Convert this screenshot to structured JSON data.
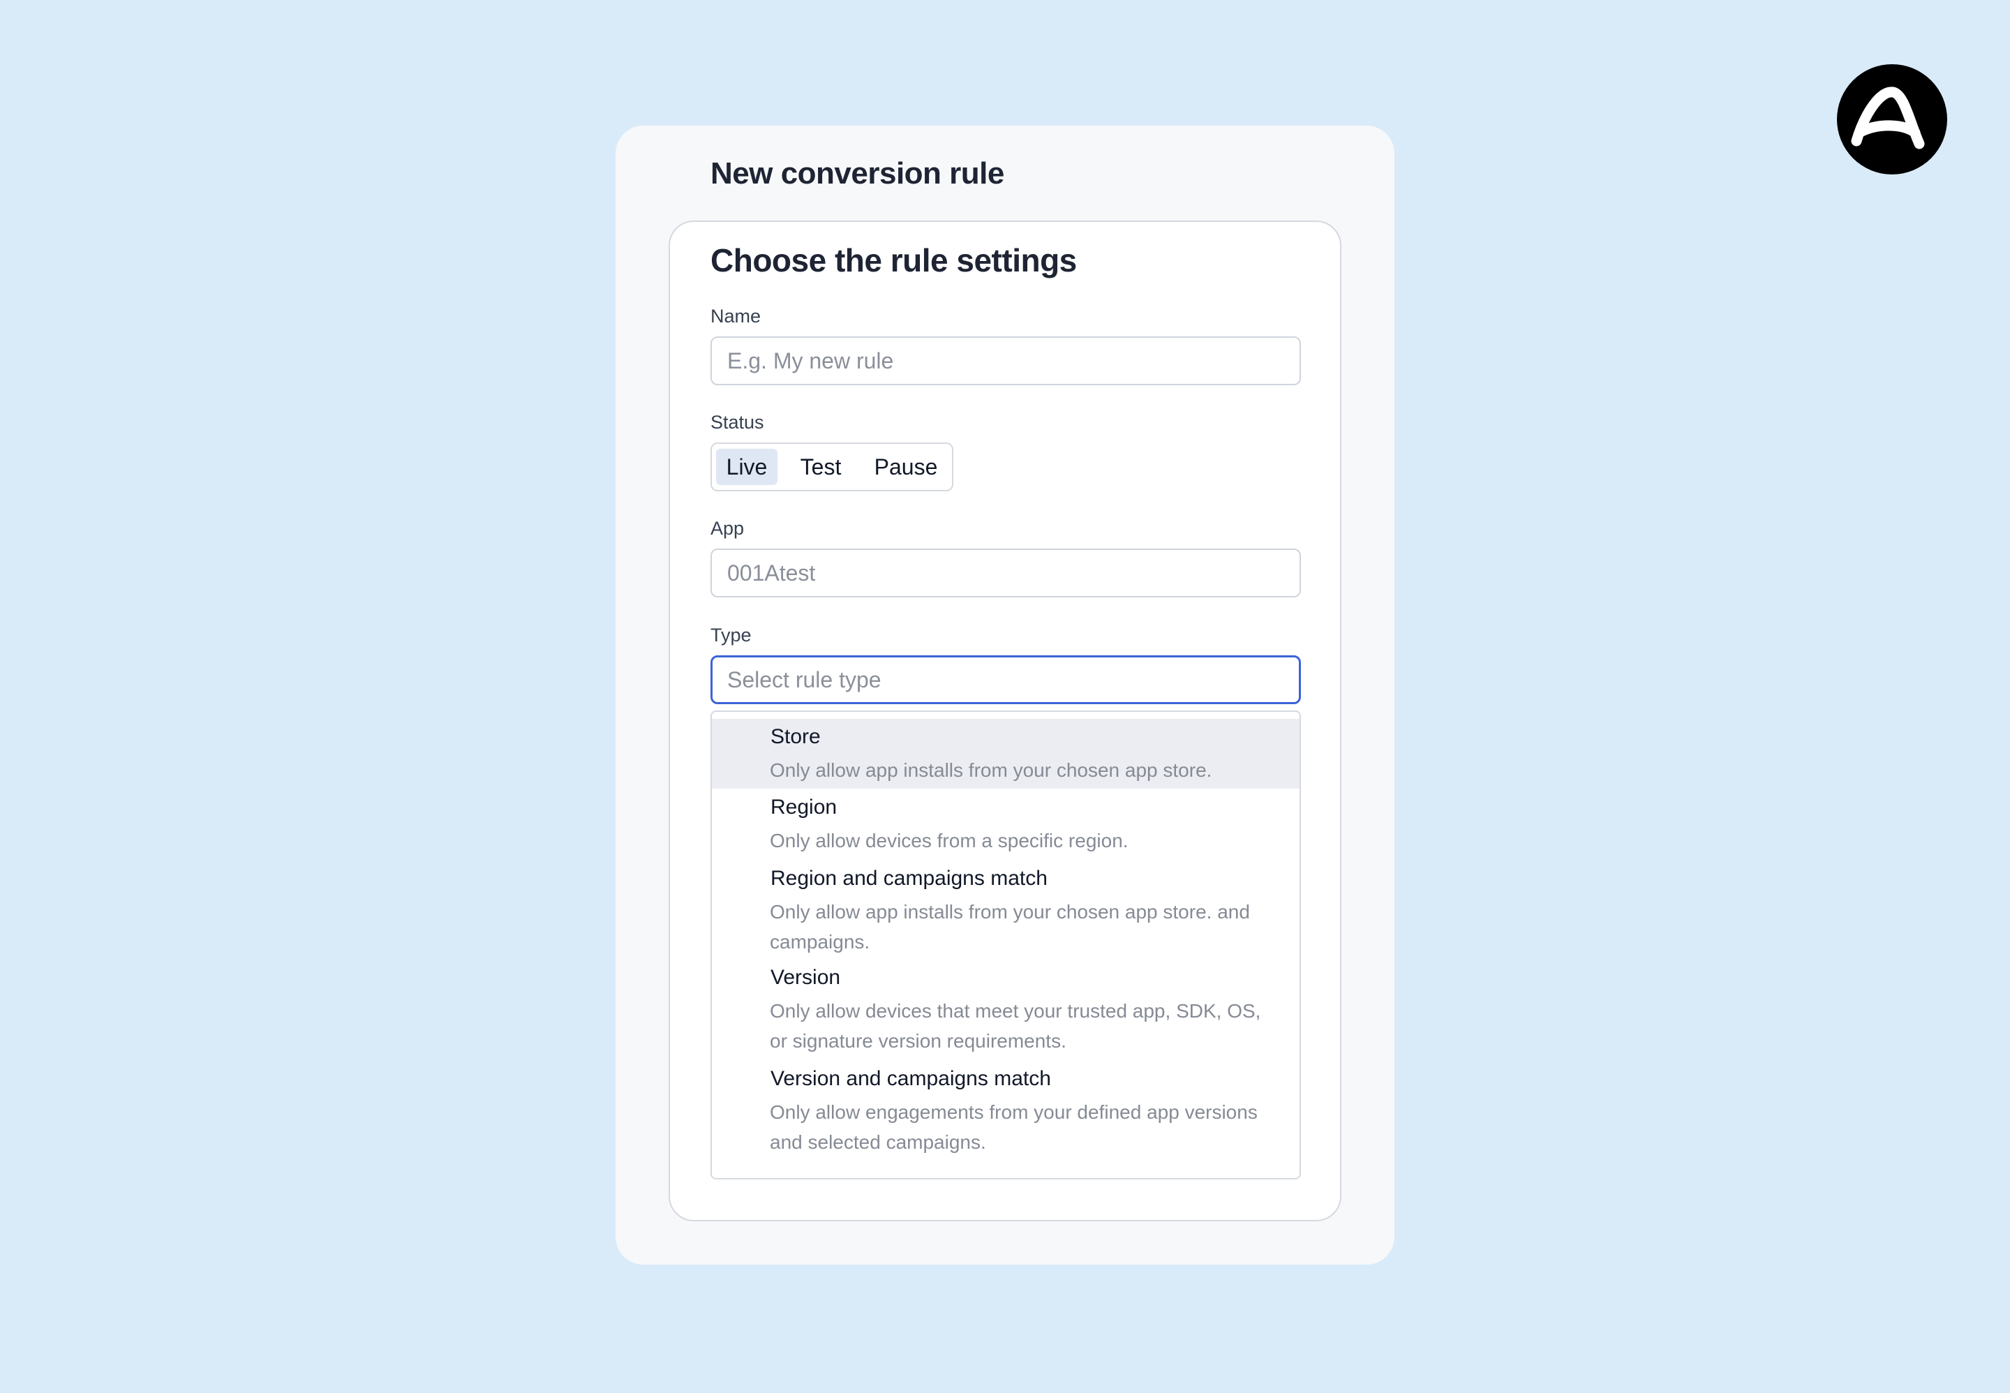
{
  "brand": {
    "logo_icon": "adjust-logo-icon",
    "logo_bg_color": "#000000"
  },
  "modal": {
    "title": "New conversion rule"
  },
  "card": {
    "title": "Choose the rule settings"
  },
  "form": {
    "name": {
      "label": "Name",
      "value": "",
      "placeholder": "E.g. My new rule"
    },
    "status": {
      "label": "Status",
      "options": [
        "Live",
        "Test",
        "Pause"
      ],
      "selected": "Live"
    },
    "app": {
      "label": "App",
      "value": "",
      "placeholder": "001Atest"
    },
    "type": {
      "label": "Type",
      "value": "",
      "placeholder": "Select rule type",
      "options": [
        {
          "title": "Store",
          "description": "Only allow app installs from your chosen app store."
        },
        {
          "title": "Region",
          "description": "Only allow devices from a specific region."
        },
        {
          "title": "Region and campaigns match",
          "description": "Only allow app installs from your chosen app store. and campaigns."
        },
        {
          "title": "Version",
          "description": "Only allow devices that meet your trusted app, SDK, OS, or signature version requirements."
        },
        {
          "title": "Version and campaigns match",
          "description": "Only allow engagements from your defined app versions and selected campaigns."
        }
      ],
      "highlighted": "Store"
    }
  },
  "colors": {
    "page_background": "#d9ebf9",
    "focus_border": "#3b64d6",
    "active_segment": "#dfe7f5",
    "highlighted_option": "#ebedf2"
  }
}
